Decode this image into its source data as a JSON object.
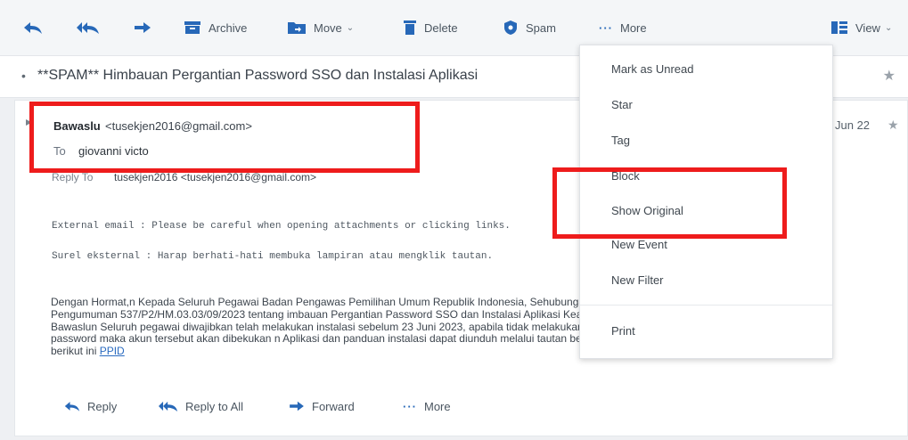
{
  "toolbar": {
    "archive_label": "Archive",
    "move_label": "Move",
    "delete_label": "Delete",
    "spam_label": "Spam",
    "more_label": "More",
    "view_label": "View",
    "icons": [
      "reply-icon",
      "reply-all-icon",
      "forward-icon",
      "archive-icon",
      "folder-icon",
      "trash-icon",
      "shield-icon",
      "more-dots-icon",
      "view-icon"
    ]
  },
  "subject": {
    "text": "**SPAM** Himbauan Pergantian Password SSO dan Instalasi Aplikasi"
  },
  "message": {
    "sender_name": "Bawaslu",
    "sender_email": "<tusekjen2016@gmail.com>",
    "to_label": "To",
    "to_value": "giovanni victo",
    "reply_to_label": "Reply To",
    "reply_to_value": "tusekjen2016 <tusekjen2016@gmail.com>",
    "date": "Jun 22",
    "warning_en": "External email : Please be careful when opening attachments or clicking links.",
    "warning_id": "Surel eksternal : Harap berhati-hati membuka lampiran atau mengklik tautan.",
    "body_lines": [
      "Dengan Hormat,n Kepada Seluruh Pegawai Badan Pengawas Pemilihan Umum Republik Indonesia, Sehubungan dengan Surat",
      "Pengumuman 537/P2/HM.03.03/09/2023 tentang imbauan Pergantian Password SSO dan Instalasi Aplikasi Keamanan di",
      "Bawaslun Seluruh pegawai diwajibkan telah melakukan instalasi sebelum 23 Juni 2023, apabila tidak melakukan pergantian",
      "password maka akun tersebut akan dibekukan n Aplikasi dan panduan instalasi dapat diunduh melalui tautan berikut ini:"
    ],
    "body_last_prefix": "berikut ini ",
    "body_link": "PPID"
  },
  "actions": {
    "reply_label": "Reply",
    "reply_all_label": "Reply to All",
    "forward_label": "Forward",
    "more_label": "More"
  },
  "menu": {
    "items": [
      "Mark as Unread",
      "Star",
      "Tag",
      "Block",
      "Show Original",
      "New Event",
      "New Filter",
      "Print"
    ]
  },
  "colors": {
    "accent": "#2768b8",
    "annotation_red": "#ee1c1c"
  }
}
